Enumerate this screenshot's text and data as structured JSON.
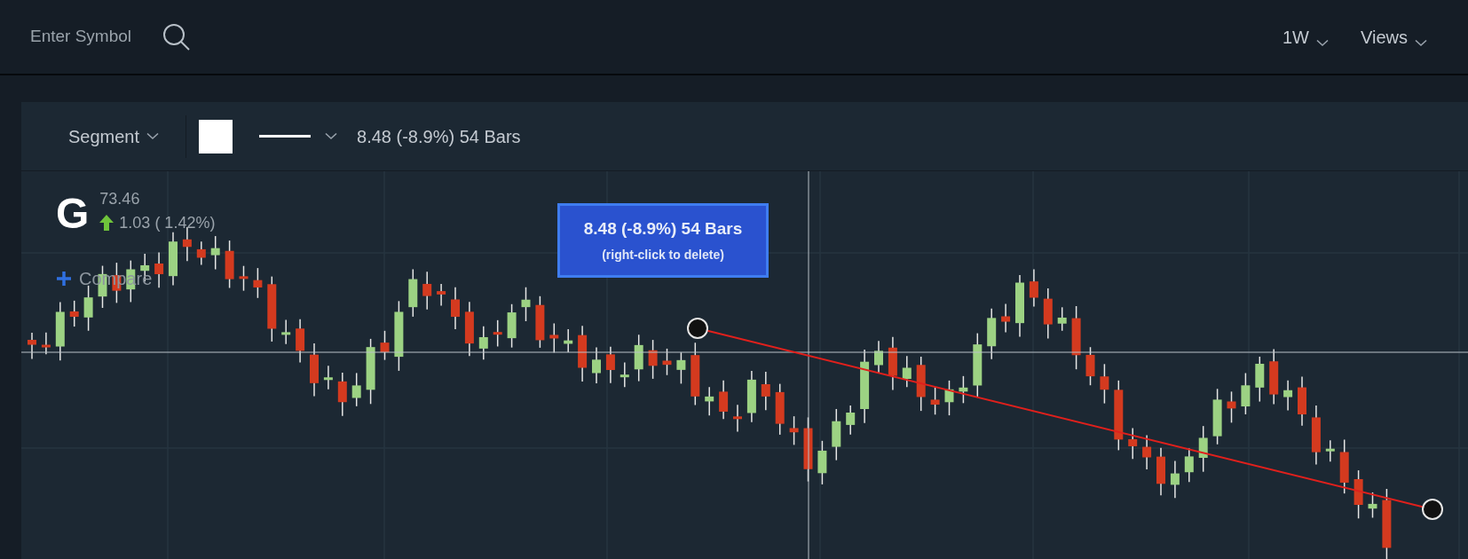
{
  "top_bar": {
    "symbol_search": {
      "placeholder": "Enter Symbol"
    },
    "interval": "1W",
    "views": "Views"
  },
  "toolbar": {
    "tool": "Segment",
    "measurement": "8.48 (-8.9%) 54 Bars"
  },
  "legend": {
    "symbol": "G",
    "price": "73.46",
    "change": "1.03 ( 1.42%)",
    "rising": true,
    "compare": "Compare"
  },
  "tooltip": {
    "title": "8.48 (-8.9%) 54 Bars",
    "hint": "(right-click to delete)"
  }
}
